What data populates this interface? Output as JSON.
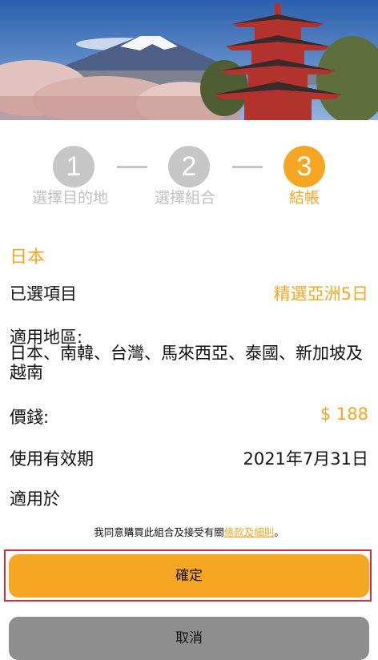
{
  "hero": {
    "icon": "mount-fuji-pagoda-photo"
  },
  "stepper": {
    "steps": [
      {
        "number": "1",
        "label": "選擇目的地",
        "active": false
      },
      {
        "number": "2",
        "label": "選擇組合",
        "active": false
      },
      {
        "number": "3",
        "label": "結帳",
        "active": true
      }
    ],
    "active_color": "#f5a623",
    "inactive_color": "#c6c6c6"
  },
  "summary": {
    "country": "日本",
    "selected_item_label": "已選項目",
    "selected_item_value": "精選亞洲5日",
    "regions_label": "適用地區:",
    "regions_value": "日本、南韓、台灣、馬來西亞、泰國、新加坡及越南",
    "price_label": "價錢:",
    "price_value": "$ 188",
    "validity_label": "使用有效期",
    "validity_value": "2021年7月31日",
    "applicable_label": "適用於"
  },
  "agreement": {
    "prefix": "我同意購買此組合及接受有關",
    "link": "條款及細則",
    "suffix": "。"
  },
  "buttons": {
    "confirm": "確定",
    "cancel": "取消"
  },
  "colors": {
    "accent": "#f5a623",
    "highlight_border": "#d62d3a",
    "cancel_bg": "#8e8e8e"
  }
}
